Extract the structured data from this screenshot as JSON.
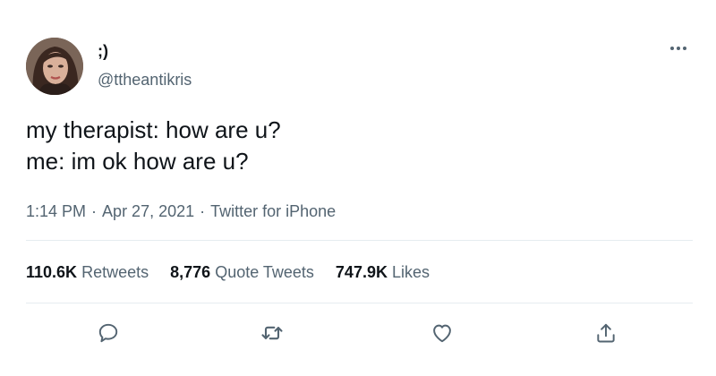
{
  "user": {
    "display_name": ";)",
    "handle": "@ttheantikris"
  },
  "tweet": {
    "lines": [
      "my therapist: how are u?",
      "me: im ok how are u?"
    ]
  },
  "meta": {
    "time": "1:14 PM",
    "separator": "·",
    "date": "Apr 27, 2021",
    "source": "Twitter for iPhone"
  },
  "stats": {
    "retweets_count": "110.6K",
    "retweets_label": "Retweets",
    "quotes_count": "8,776",
    "quotes_label": "Quote Tweets",
    "likes_count": "747.9K",
    "likes_label": "Likes"
  },
  "icons": {
    "more": "more-dots-icon",
    "reply": "reply-icon",
    "retweet": "retweet-icon",
    "like": "heart-icon",
    "share": "share-icon"
  },
  "colors": {
    "text": "#0f1419",
    "secondary": "#536471",
    "divider": "#e6ecf0",
    "icon": "#536471"
  }
}
